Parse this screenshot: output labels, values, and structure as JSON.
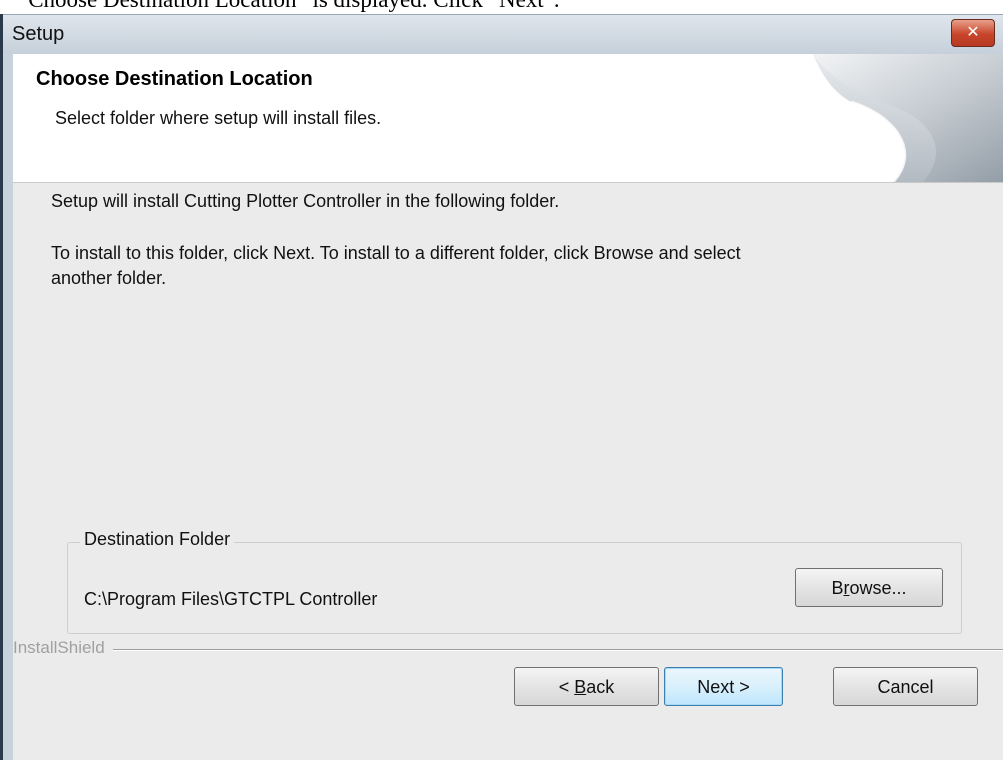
{
  "caption": "“Choose Destination Location” is displayed. Click “Next”.",
  "window": {
    "title": "Setup",
    "close_label": "✕"
  },
  "header": {
    "heading": "Choose Destination Location",
    "subheading": "Select folder where setup will install files."
  },
  "body": {
    "line1": "Setup will install Cutting Plotter Controller in the following folder.",
    "line2a": "To install to this folder, click Next. To install to a different folder, click Browse and select",
    "line2b": "another folder."
  },
  "destination": {
    "legend": "Destination Folder",
    "path": "C:\\Program Files\\GTCTPL Controller",
    "browse": {
      "pre": "B",
      "accel": "r",
      "post": "owse..."
    }
  },
  "footer": {
    "brand": "InstallShield",
    "back": {
      "pre": "< ",
      "accel": "B",
      "post": "ack"
    },
    "next_label": "Next >",
    "cancel_label": "Cancel"
  },
  "colors": {
    "dialog_bg": "#ebebeb",
    "header_bg": "#ffffff",
    "close_button": "#c8452b",
    "default_button": "#bee6fd"
  },
  "icons": {
    "close": "close-icon",
    "header_art": "page-curl-art"
  }
}
